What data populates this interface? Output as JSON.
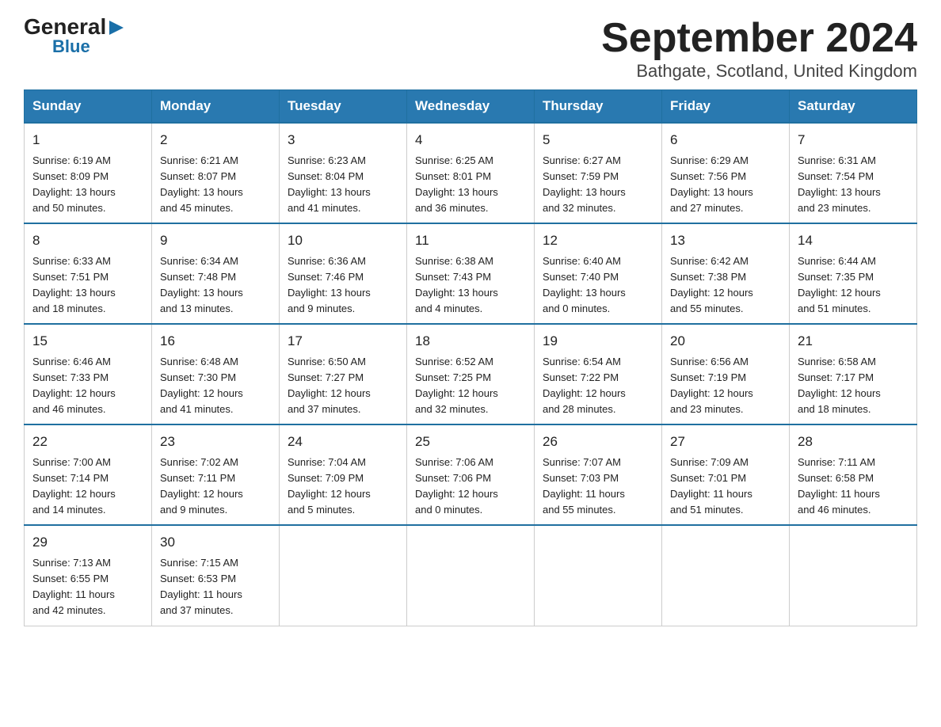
{
  "logo": {
    "general": "General",
    "triangle": "▶",
    "blue": "Blue"
  },
  "title": "September 2024",
  "subtitle": "Bathgate, Scotland, United Kingdom",
  "weekdays": [
    "Sunday",
    "Monday",
    "Tuesday",
    "Wednesday",
    "Thursday",
    "Friday",
    "Saturday"
  ],
  "weeks": [
    [
      {
        "day": 1,
        "sunrise": "6:19 AM",
        "sunset": "8:09 PM",
        "daylight": "13 hours and 50 minutes."
      },
      {
        "day": 2,
        "sunrise": "6:21 AM",
        "sunset": "8:07 PM",
        "daylight": "13 hours and 45 minutes."
      },
      {
        "day": 3,
        "sunrise": "6:23 AM",
        "sunset": "8:04 PM",
        "daylight": "13 hours and 41 minutes."
      },
      {
        "day": 4,
        "sunrise": "6:25 AM",
        "sunset": "8:01 PM",
        "daylight": "13 hours and 36 minutes."
      },
      {
        "day": 5,
        "sunrise": "6:27 AM",
        "sunset": "7:59 PM",
        "daylight": "13 hours and 32 minutes."
      },
      {
        "day": 6,
        "sunrise": "6:29 AM",
        "sunset": "7:56 PM",
        "daylight": "13 hours and 27 minutes."
      },
      {
        "day": 7,
        "sunrise": "6:31 AM",
        "sunset": "7:54 PM",
        "daylight": "13 hours and 23 minutes."
      }
    ],
    [
      {
        "day": 8,
        "sunrise": "6:33 AM",
        "sunset": "7:51 PM",
        "daylight": "13 hours and 18 minutes."
      },
      {
        "day": 9,
        "sunrise": "6:34 AM",
        "sunset": "7:48 PM",
        "daylight": "13 hours and 13 minutes."
      },
      {
        "day": 10,
        "sunrise": "6:36 AM",
        "sunset": "7:46 PM",
        "daylight": "13 hours and 9 minutes."
      },
      {
        "day": 11,
        "sunrise": "6:38 AM",
        "sunset": "7:43 PM",
        "daylight": "13 hours and 4 minutes."
      },
      {
        "day": 12,
        "sunrise": "6:40 AM",
        "sunset": "7:40 PM",
        "daylight": "13 hours and 0 minutes."
      },
      {
        "day": 13,
        "sunrise": "6:42 AM",
        "sunset": "7:38 PM",
        "daylight": "12 hours and 55 minutes."
      },
      {
        "day": 14,
        "sunrise": "6:44 AM",
        "sunset": "7:35 PM",
        "daylight": "12 hours and 51 minutes."
      }
    ],
    [
      {
        "day": 15,
        "sunrise": "6:46 AM",
        "sunset": "7:33 PM",
        "daylight": "12 hours and 46 minutes."
      },
      {
        "day": 16,
        "sunrise": "6:48 AM",
        "sunset": "7:30 PM",
        "daylight": "12 hours and 41 minutes."
      },
      {
        "day": 17,
        "sunrise": "6:50 AM",
        "sunset": "7:27 PM",
        "daylight": "12 hours and 37 minutes."
      },
      {
        "day": 18,
        "sunrise": "6:52 AM",
        "sunset": "7:25 PM",
        "daylight": "12 hours and 32 minutes."
      },
      {
        "day": 19,
        "sunrise": "6:54 AM",
        "sunset": "7:22 PM",
        "daylight": "12 hours and 28 minutes."
      },
      {
        "day": 20,
        "sunrise": "6:56 AM",
        "sunset": "7:19 PM",
        "daylight": "12 hours and 23 minutes."
      },
      {
        "day": 21,
        "sunrise": "6:58 AM",
        "sunset": "7:17 PM",
        "daylight": "12 hours and 18 minutes."
      }
    ],
    [
      {
        "day": 22,
        "sunrise": "7:00 AM",
        "sunset": "7:14 PM",
        "daylight": "12 hours and 14 minutes."
      },
      {
        "day": 23,
        "sunrise": "7:02 AM",
        "sunset": "7:11 PM",
        "daylight": "12 hours and 9 minutes."
      },
      {
        "day": 24,
        "sunrise": "7:04 AM",
        "sunset": "7:09 PM",
        "daylight": "12 hours and 5 minutes."
      },
      {
        "day": 25,
        "sunrise": "7:06 AM",
        "sunset": "7:06 PM",
        "daylight": "12 hours and 0 minutes."
      },
      {
        "day": 26,
        "sunrise": "7:07 AM",
        "sunset": "7:03 PM",
        "daylight": "11 hours and 55 minutes."
      },
      {
        "day": 27,
        "sunrise": "7:09 AM",
        "sunset": "7:01 PM",
        "daylight": "11 hours and 51 minutes."
      },
      {
        "day": 28,
        "sunrise": "7:11 AM",
        "sunset": "6:58 PM",
        "daylight": "11 hours and 46 minutes."
      }
    ],
    [
      {
        "day": 29,
        "sunrise": "7:13 AM",
        "sunset": "6:55 PM",
        "daylight": "11 hours and 42 minutes."
      },
      {
        "day": 30,
        "sunrise": "7:15 AM",
        "sunset": "6:53 PM",
        "daylight": "11 hours and 37 minutes."
      },
      null,
      null,
      null,
      null,
      null
    ]
  ],
  "labels": {
    "sunrise": "Sunrise:",
    "sunset": "Sunset:",
    "daylight": "Daylight:"
  }
}
